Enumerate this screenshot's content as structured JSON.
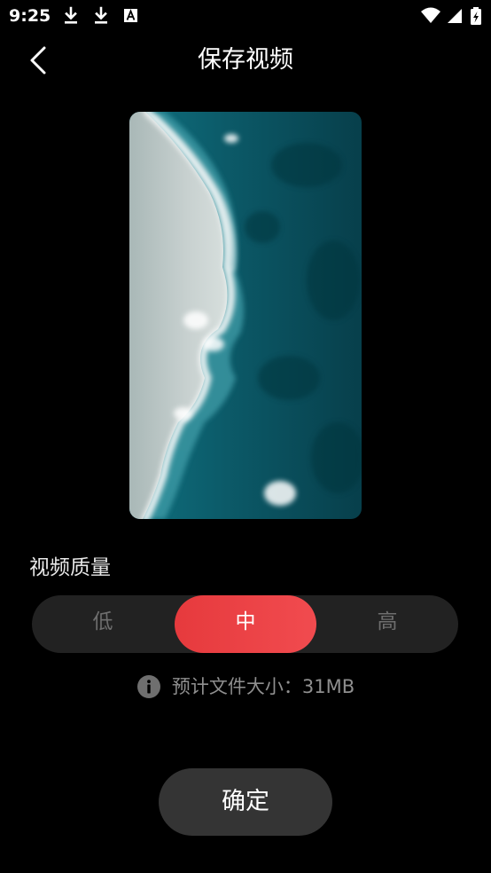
{
  "status_bar": {
    "time": "9:25",
    "icons": [
      "download-icon",
      "download-icon",
      "text-notification-icon",
      "wifi-icon",
      "cellular-signal-icon",
      "battery-charging-icon"
    ]
  },
  "header": {
    "title": "保存视频",
    "back_icon": "chevron-left-icon"
  },
  "quality": {
    "label": "视频质量",
    "options": [
      "低",
      "中",
      "高"
    ],
    "selected": "中",
    "accent_color": "#f0474b"
  },
  "filesize": {
    "icon": "info-icon",
    "text": "预计文件大小：31MB"
  },
  "confirm": {
    "label": "确定"
  }
}
